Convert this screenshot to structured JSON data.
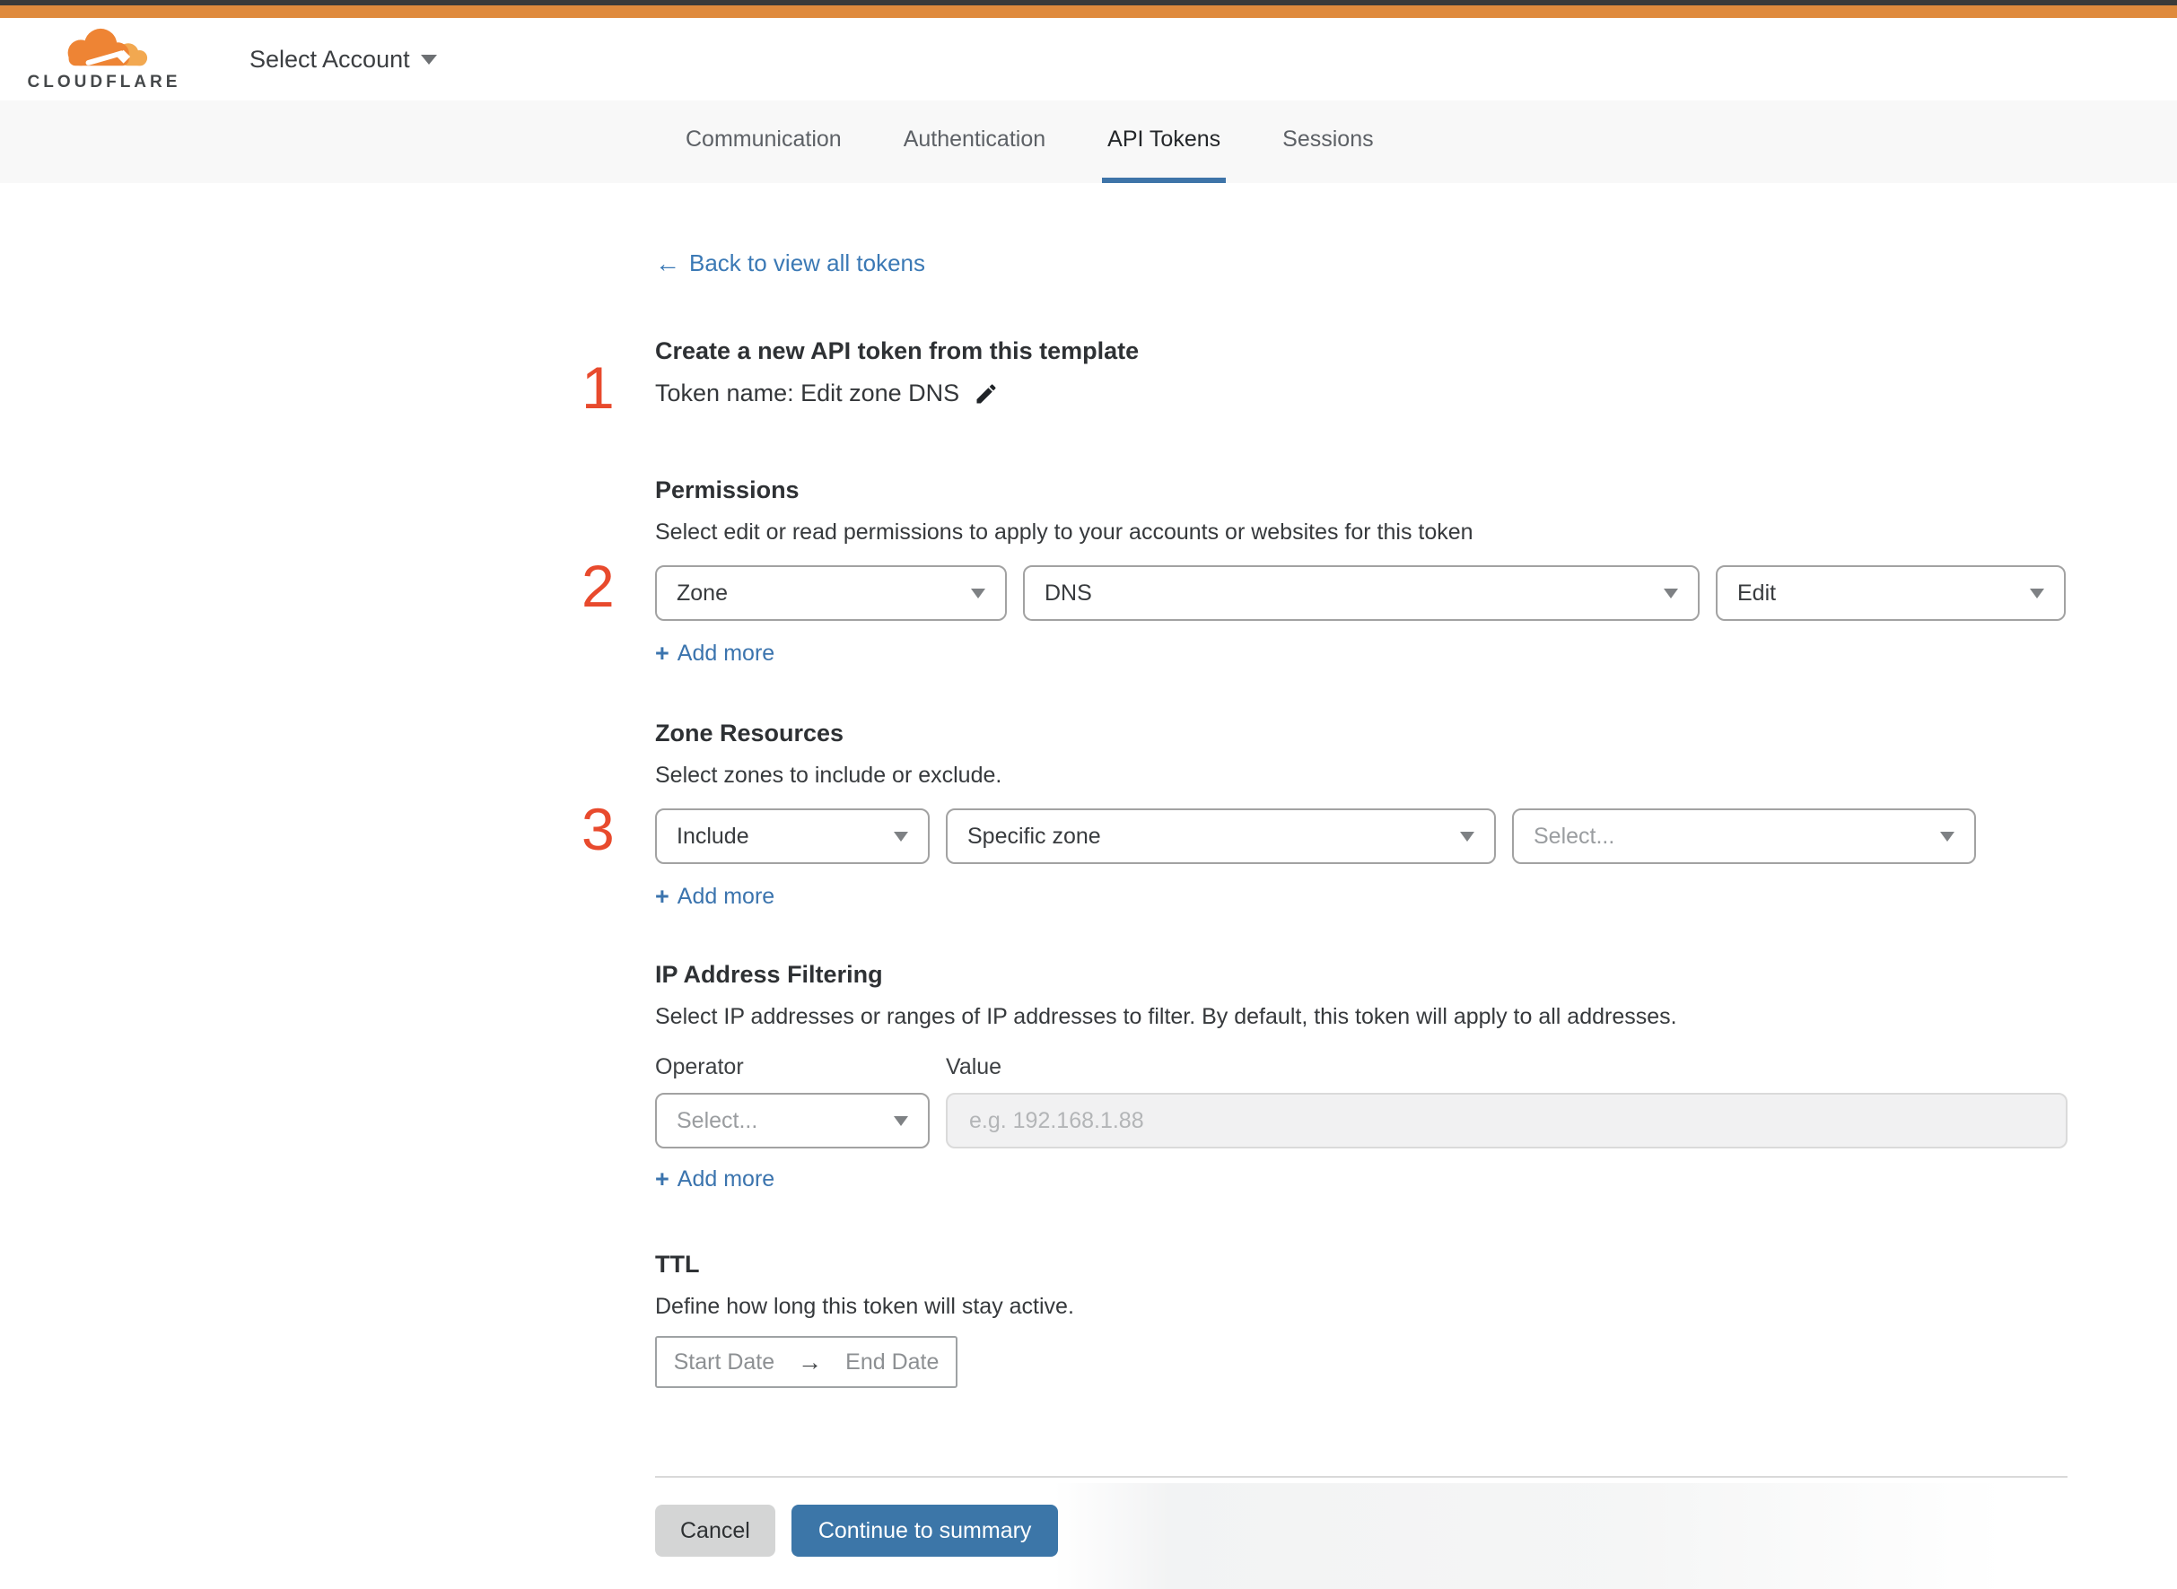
{
  "header": {
    "brand": "CLOUDFLARE",
    "account_selector": "Select Account"
  },
  "tabs": {
    "items": [
      {
        "label": "Communication",
        "active": false
      },
      {
        "label": "Authentication",
        "active": false
      },
      {
        "label": "API Tokens",
        "active": true
      },
      {
        "label": "Sessions",
        "active": false
      }
    ]
  },
  "back_link": {
    "arrow": "←",
    "label": "Back to view all tokens"
  },
  "template_section": {
    "step": "1",
    "title": "Create a new API token from this template",
    "token_name": "Token name: Edit zone DNS"
  },
  "permissions": {
    "step": "2",
    "title": "Permissions",
    "subtitle": "Select edit or read permissions to apply to your accounts or websites for this token",
    "scope_value": "Zone",
    "service_value": "DNS",
    "access_value": "Edit",
    "add_more": "Add more"
  },
  "zone_resources": {
    "step": "3",
    "title": "Zone Resources",
    "subtitle": "Select zones to include or exclude.",
    "mode_value": "Include",
    "scope_value": "Specific zone",
    "zone_placeholder": "Select...",
    "add_more": "Add more"
  },
  "ip_filtering": {
    "title": "IP Address Filtering",
    "subtitle": "Select IP addresses or ranges of IP addresses to filter. By default, this token will apply to all addresses.",
    "operator_label": "Operator",
    "value_label": "Value",
    "operator_placeholder": "Select...",
    "value_placeholder": "e.g. 192.168.1.88",
    "add_more": "Add more"
  },
  "ttl": {
    "title": "TTL",
    "subtitle": "Define how long this token will stay active.",
    "start_label": "Start Date",
    "arrow": "→",
    "end_label": "End Date"
  },
  "footer": {
    "cancel": "Cancel",
    "continue": "Continue to summary"
  },
  "icons": {
    "plus": "+"
  },
  "colors": {
    "topbar_dark": "#3a3a3a",
    "topbar_orange": "#df8a3d",
    "brand_orange": "#ee8434",
    "brand_orange_light": "#f2a850",
    "accent_blue": "#3c76a8",
    "link_blue": "#3b74ae",
    "tab_underline_blue": "#3e74a8",
    "step_red": "#e84a2d"
  }
}
